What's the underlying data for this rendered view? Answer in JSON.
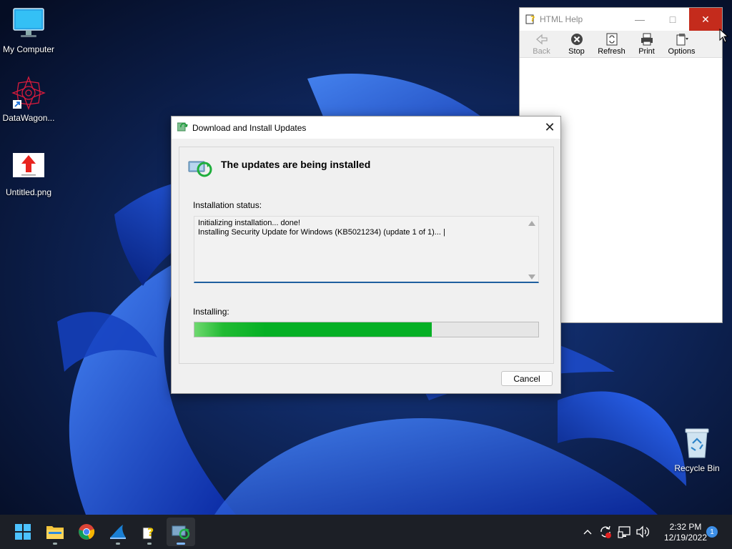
{
  "desktop": {
    "icons": [
      {
        "label": "My Computer"
      },
      {
        "label": "DataWagon..."
      },
      {
        "label": "Untitled.png"
      },
      {
        "label": "Recycle Bin"
      }
    ]
  },
  "help_window": {
    "title": "HTML Help",
    "toolbar": {
      "back": "Back",
      "stop": "Stop",
      "refresh": "Refresh",
      "print": "Print",
      "options": "Options"
    }
  },
  "dialog": {
    "title": "Download and Install Updates",
    "heading": "The updates are being installed",
    "status_label": "Installation status:",
    "status_lines": [
      "Initializing installation... done!",
      "Installing Security Update for Windows (KB5021234) (update 1 of 1)... |"
    ],
    "installing_label": "Installing:",
    "progress_fraction": 0.69,
    "cancel_label": "Cancel"
  },
  "taskbar": {
    "apps": [
      "start-icon",
      "file-explorer-icon",
      "chrome-icon",
      "shark-icon",
      "help-icon",
      "windows-update-icon"
    ],
    "clock_time": "2:32 PM",
    "clock_date": "12/19/2022",
    "notification_count": "1"
  },
  "colors": {
    "progress": "#06b025",
    "close_red": "#c42b1c",
    "taskbar": "#1c1f26",
    "accent_blue": "#1f5f9f"
  }
}
